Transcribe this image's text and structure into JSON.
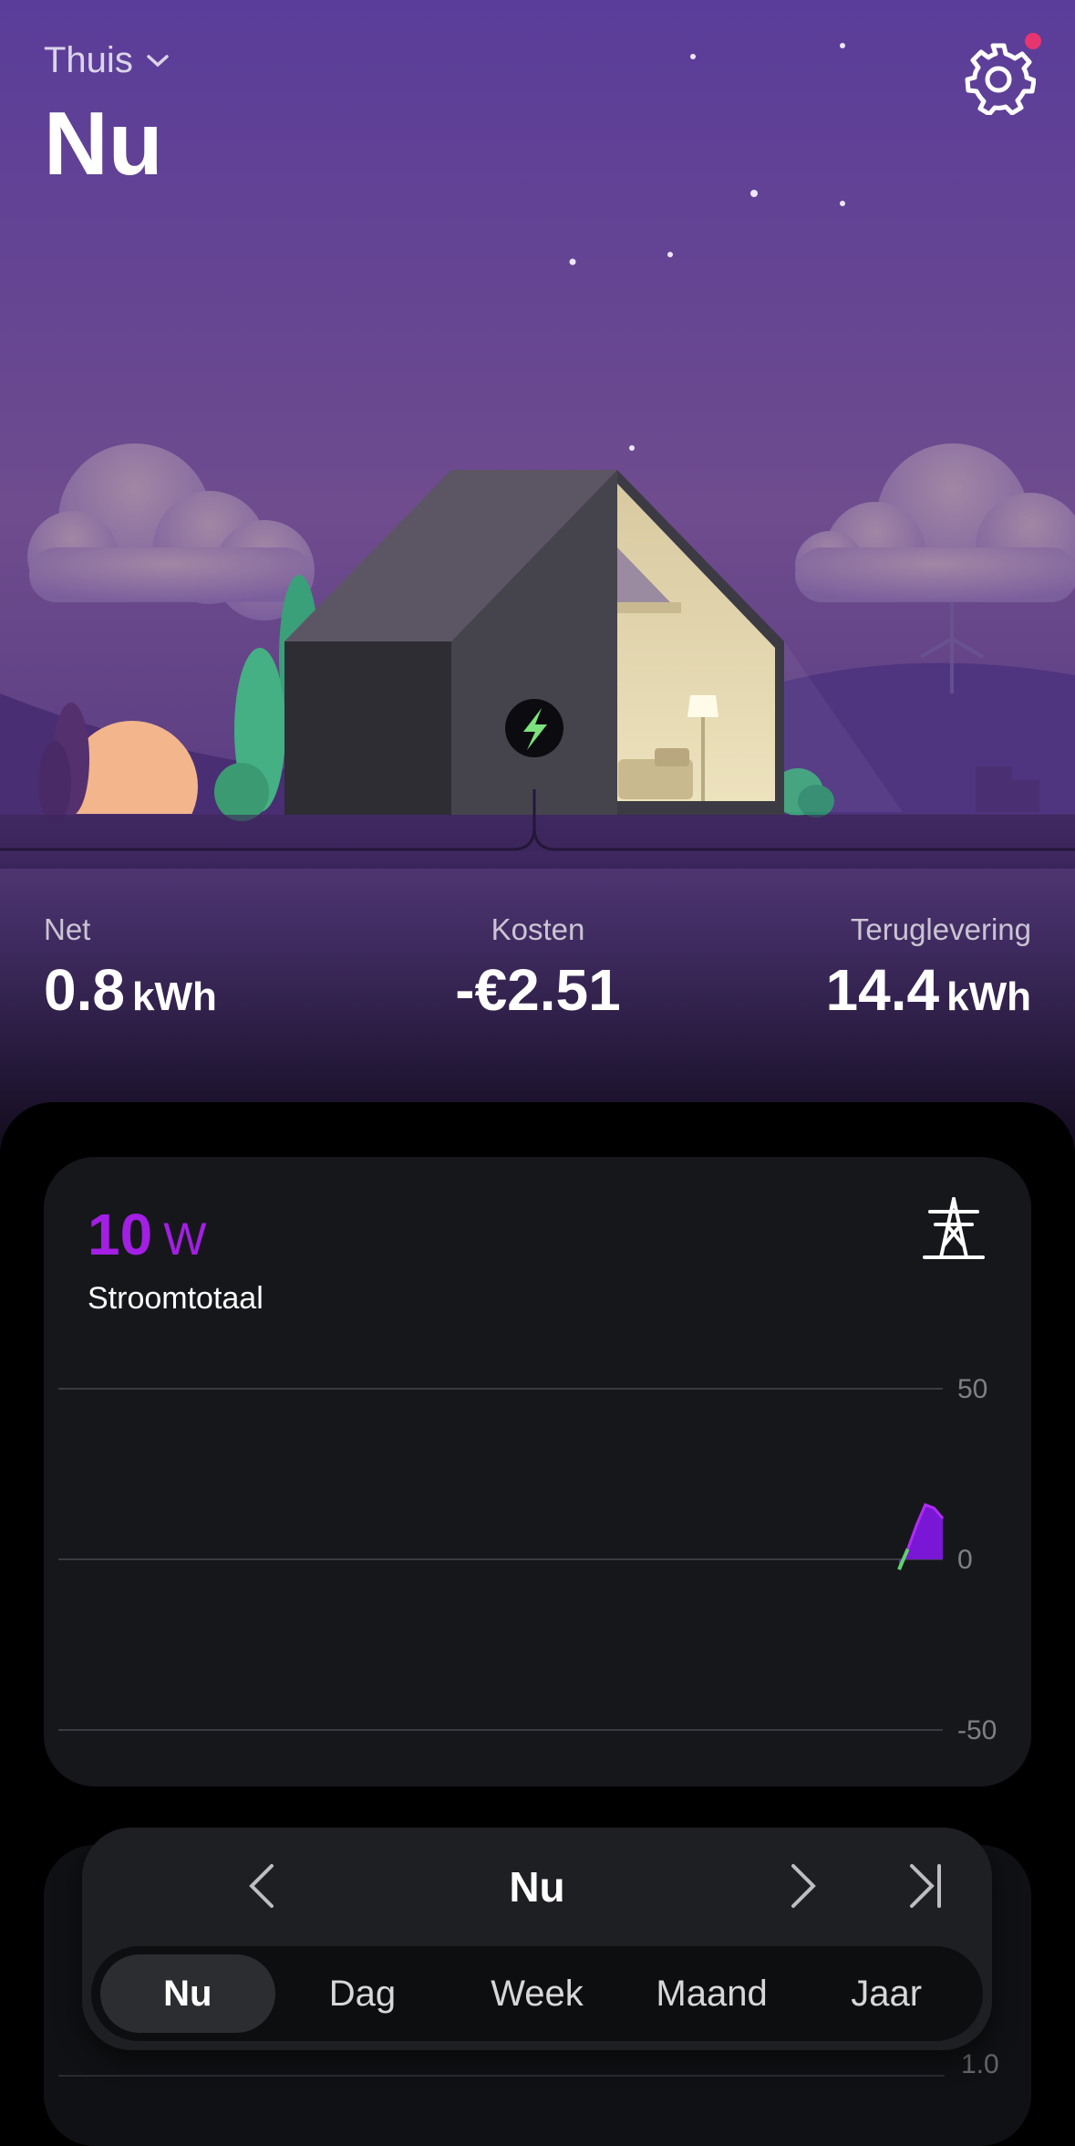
{
  "header": {
    "location": "Thuis",
    "title": "Nu"
  },
  "stats": {
    "net": {
      "label": "Net",
      "value": "0.8",
      "unit": "kWh"
    },
    "costs": {
      "label": "Kosten",
      "value": "-€2.51"
    },
    "feed_in": {
      "label": "Teruglevering",
      "value": "14.4",
      "unit": "kWh"
    }
  },
  "power_card": {
    "value": "10",
    "unit": "W",
    "label": "Stroomtotaal",
    "accent": "#a21fe3"
  },
  "chart_data": {
    "type": "area",
    "y_ticks": [
      "50",
      "0",
      "-50"
    ],
    "ylim": [
      -50,
      50
    ],
    "grid": true,
    "x": [
      0,
      1,
      2,
      3,
      4,
      5
    ],
    "values": [
      -3,
      3,
      10,
      16,
      15,
      12
    ],
    "colors": {
      "fill": "#7a16d6",
      "line": "#b02cf2",
      "start_line": "#5fd16d"
    }
  },
  "second_card": {
    "tick": "1.0"
  },
  "period_nav": {
    "current": "Nu",
    "tabs": [
      "Nu",
      "Dag",
      "Week",
      "Maand",
      "Jaar"
    ],
    "active_index": 0
  }
}
